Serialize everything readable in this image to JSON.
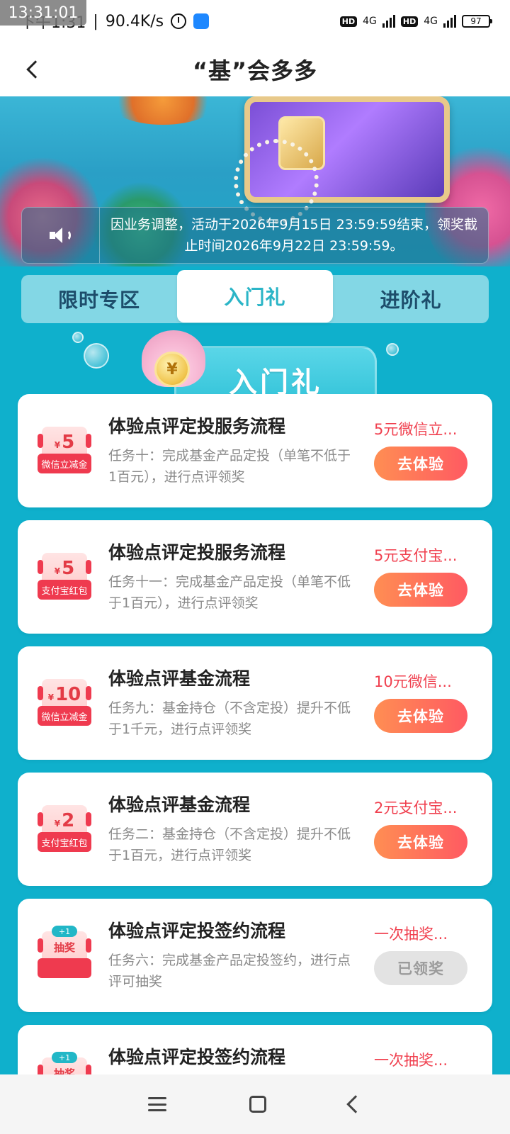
{
  "status_bar": {
    "time_overlay": "13:31:01",
    "clock": "下午1:31",
    "net_speed": "90.4K/s",
    "sim1": "4G",
    "sim2": "4G",
    "hd1": "HD",
    "hd2": "HD",
    "battery": "97"
  },
  "header": {
    "title": "“基”会多多",
    "back_icon": "chevron-left-icon"
  },
  "notice": {
    "text": "因业务调整，活动于2026年9月15日 23:59:59结束，领奖截止时间2026年9月22日 23:59:59。",
    "icon": "speaker-icon"
  },
  "tabs": [
    {
      "label": "限时专区",
      "active": false
    },
    {
      "label": "入门礼",
      "active": true
    },
    {
      "label": "进阶礼",
      "active": false
    }
  ],
  "section": {
    "title": "入门礼",
    "coin_symbol": "¥"
  },
  "tasks": [
    {
      "title": "体验点评定投服务流程",
      "desc": "任务十：完成基金产品定投（单笔不低于1百元），进行点评领奖",
      "reward_amount": "5",
      "reward_type": "微信立减金",
      "reward_name": "5元微信立...",
      "button": "去体验"
    },
    {
      "title": "体验点评定投服务流程",
      "desc": "任务十一：完成基金产品定投（单笔不低于1百元），进行点评领奖",
      "reward_amount": "5",
      "reward_type": "支付宝红包",
      "reward_name": "5元支付宝...",
      "button": "去体验"
    },
    {
      "title": "体验点评基金流程",
      "desc": "任务九：基金持仓（不含定投）提升不低于1千元，进行点评领奖",
      "reward_amount": "10",
      "reward_type": "微信立减金",
      "reward_name": "10元微信...",
      "button": "去体验"
    },
    {
      "title": "体验点评基金流程",
      "desc": "任务二：基金持仓（不含定投）提升不低于1百元，进行点评领奖",
      "reward_amount": "2",
      "reward_type": "支付宝红包",
      "reward_name": "2元支付宝...",
      "button": "去体验"
    },
    {
      "title": "体验点评定投签约流程",
      "desc": "任务六：完成基金产品定投签约，进行点评可抽奖",
      "reward_badge": "+1",
      "reward_lottery": "抽奖",
      "reward_name": "一次抽奖...",
      "button": "已领奖"
    },
    {
      "title": "体验点评定投签约流程",
      "desc": "",
      "reward_badge": "+1",
      "reward_lottery": "抽奖",
      "reward_name": "一次抽奖..."
    }
  ],
  "nav": {
    "menu_icon": "menu-icon",
    "home_icon": "home-icon",
    "back_icon": "back-icon"
  }
}
